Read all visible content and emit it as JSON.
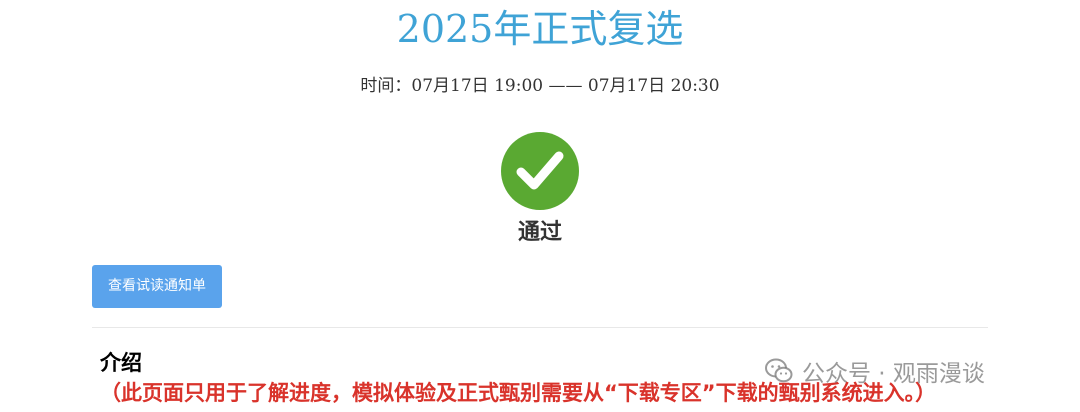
{
  "page": {
    "title": "2025年正式复选",
    "time_label": "时间：",
    "time_start": "07月17日 19:00",
    "time_separator": "——",
    "time_end": "07月17日 20:30"
  },
  "result": {
    "icon": "checkmark-icon",
    "status": "通过",
    "color": "#5aa932"
  },
  "actions": {
    "view_notice_label": "查看试读通知单",
    "button_color": "#5aa3ec"
  },
  "intro": {
    "heading": "介绍",
    "note": "（此页面只用于了解进度，模拟体验及正式甄别需要从“下载专区”下载的甄别系统进入。）",
    "note_color": "#d9332b"
  },
  "watermark": {
    "icon": "wechat-icon",
    "text": "公众号 · 观雨漫谈"
  }
}
